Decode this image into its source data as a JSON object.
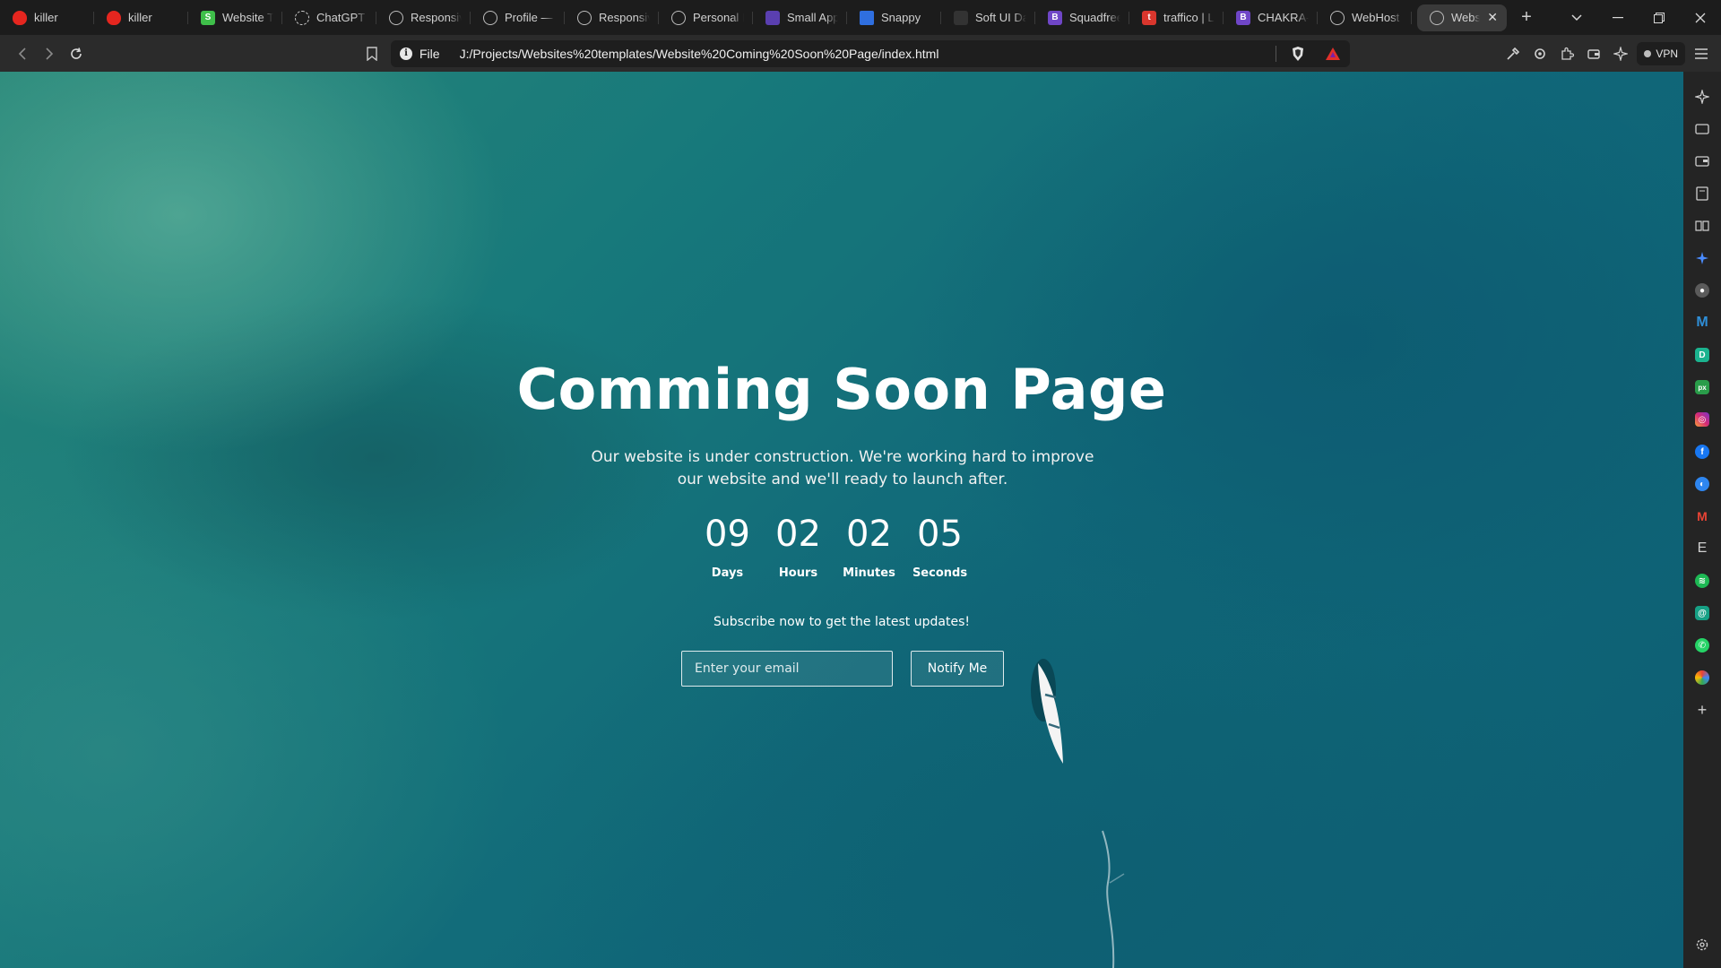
{
  "browser": {
    "tabs": [
      {
        "label": "killer",
        "favicon": "brave-icon",
        "active": false
      },
      {
        "label": "killer",
        "favicon": "brave-icon",
        "active": false
      },
      {
        "label": "Website Te",
        "favicon": "green-s-icon",
        "active": false
      },
      {
        "label": "ChatGPT",
        "favicon": "chatgpt-icon",
        "active": false
      },
      {
        "label": "Responsiv",
        "favicon": "globe-icon",
        "active": false
      },
      {
        "label": "Profile — I",
        "favicon": "globe-icon",
        "active": false
      },
      {
        "label": "Responsiv",
        "favicon": "globe-icon",
        "active": false
      },
      {
        "label": "Personal P",
        "favicon": "globe-icon",
        "active": false
      },
      {
        "label": "Small App",
        "favicon": "purple-icon",
        "active": false
      },
      {
        "label": "Snappy",
        "favicon": "snappy-icon",
        "active": false
      },
      {
        "label": "Soft UI Da",
        "favicon": "softui-icon",
        "active": false
      },
      {
        "label": "Squadfree",
        "favicon": "bootstrap-icon",
        "active": false
      },
      {
        "label": "traffico | L",
        "favicon": "traffico-icon",
        "active": false
      },
      {
        "label": "CHAKRA-(",
        "favicon": "bootstrap-icon",
        "active": false
      },
      {
        "label": "WebHost",
        "favicon": "globe-icon",
        "active": false
      },
      {
        "label": "Webs",
        "favicon": "globe-icon",
        "active": true
      }
    ],
    "address": {
      "scheme": "File",
      "url": "J:/Projects/Websites%20templates/Website%20Coming%20Soon%20Page/index.html"
    },
    "vpn_label": "VPN"
  },
  "page": {
    "title": "Comming Soon Page",
    "subtitle": "Our website is under construction. We're working hard to improve our website and we'll ready to launch after.",
    "countdown": [
      {
        "value": "09",
        "label": "Days"
      },
      {
        "value": "02",
        "label": "Hours"
      },
      {
        "value": "02",
        "label": "Minutes"
      },
      {
        "value": "05",
        "label": "Seconds"
      }
    ],
    "subscribe_text": "Subscribe now to get the latest updates!",
    "email_placeholder": "Enter your email",
    "notify_label": "Notify Me"
  },
  "sidebar": {
    "apps": [
      "leo-ai-icon",
      "wallet-icon",
      "bookmarks-icon",
      "reading-list-icon",
      "history-icon",
      "star-icon",
      "brave-talk-icon",
      "m-app-icon",
      "teal-app-icon",
      "pixlr-icon",
      "instagram-icon",
      "facebook-icon",
      "messenger-icon",
      "gmail-icon",
      "e-icon",
      "spotify-icon",
      "green-app-icon",
      "whatsapp-icon",
      "colored-app-icon",
      "add-icon"
    ]
  },
  "colors": {
    "accent": "#ffffff",
    "sea_dark": "#0f6c84",
    "sea_light": "#2e9a8a"
  }
}
